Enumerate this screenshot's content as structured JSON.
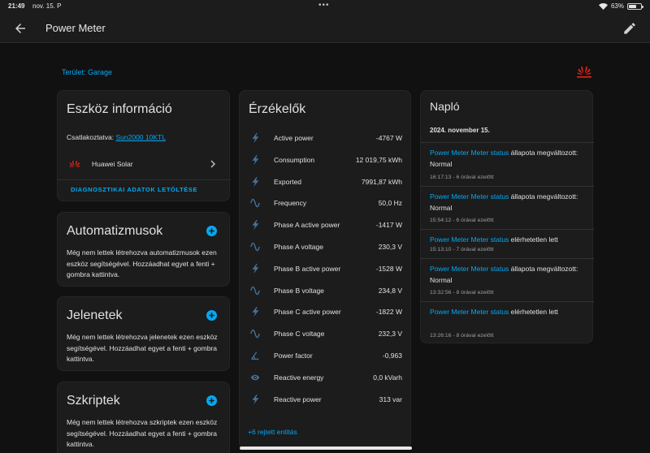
{
  "status_bar": {
    "time": "21:49",
    "date": "nov. 15. P",
    "battery": "63%",
    "battery_level": 0.63
  },
  "app_bar": {
    "title": "Power Meter",
    "back_icon": "arrow-left-icon",
    "edit_icon": "pencil-icon"
  },
  "area": "Terület: Garage",
  "device_info": {
    "title": "Eszköz információ",
    "connected_prefix": "Csatlakoztatva: ",
    "connected_link": "Sun2000 10KTL",
    "manufacturer": "Huawei Solar",
    "diagnostics_button": "DIAGNOSZTIKAI ADATOK LETÖLTÉSE"
  },
  "automations": {
    "title": "Automatizmusok",
    "text": "Még nem lettek létrehozva automatizmusok ezen eszköz segítségével. Hozzáadhat egyet a fenti + gombra kattintva."
  },
  "scenes": {
    "title": "Jelenetek",
    "text": "Még nem lettek létrehozva jelenetek ezen eszköz segítségével. Hozzáadhat egyet a fenti + gombra kattintva."
  },
  "scripts": {
    "title": "Szkriptek",
    "text": "Még nem lettek létrehozva szkriptek ezen eszköz segítségével. Hozzáadhat egyet a fenti + gombra kattintva."
  },
  "sensors": {
    "title": "Érzékelők",
    "hidden_link": "+6 rejtett entitás",
    "items": [
      {
        "label": "Active power",
        "value": "-4767 W",
        "icon": "flash-icon"
      },
      {
        "label": "Consumption",
        "value": "12 019,75 kWh",
        "icon": "flash-icon"
      },
      {
        "label": "Exported",
        "value": "7991,87 kWh",
        "icon": "flash-icon"
      },
      {
        "label": "Frequency",
        "value": "50,0 Hz",
        "icon": "sine-wave-icon"
      },
      {
        "label": "Phase A active power",
        "value": "-1417 W",
        "icon": "flash-icon"
      },
      {
        "label": "Phase A voltage",
        "value": "230,3 V",
        "icon": "sine-wave-icon"
      },
      {
        "label": "Phase B active power",
        "value": "-1528 W",
        "icon": "flash-icon"
      },
      {
        "label": "Phase B voltage",
        "value": "234,8 V",
        "icon": "sine-wave-icon"
      },
      {
        "label": "Phase C active power",
        "value": "-1822 W",
        "icon": "flash-icon"
      },
      {
        "label": "Phase C voltage",
        "value": "232,3 V",
        "icon": "sine-wave-icon"
      },
      {
        "label": "Power factor",
        "value": "-0,963",
        "icon": "angle-acute-icon"
      },
      {
        "label": "Reactive energy",
        "value": "0,0 kVarh",
        "icon": "eye-icon"
      },
      {
        "label": "Reactive power",
        "value": "313 var",
        "icon": "flash-icon"
      }
    ]
  },
  "logbook": {
    "title": "Napló",
    "date": "2024. november 15.",
    "entries": [
      {
        "entity": "Power Meter Meter status",
        "action": " állapota megváltozott: Normal",
        "meta": "16:17:13 - 6 órával ezelőtt"
      },
      {
        "entity": "Power Meter Meter status",
        "action": " állapota megváltozott: Normal",
        "meta": "15:54:12 - 6 órával ezelőtt"
      },
      {
        "entity": "Power Meter Meter status",
        "action": " elérhetetlen lett",
        "meta": "15:13:10 - 7 órával ezelőtt"
      },
      {
        "entity": "Power Meter Meter status",
        "action": " állapota megváltozott: Normal",
        "meta": "13:32:56 - 8 órával ezelőtt"
      },
      {
        "entity": "Power Meter Meter status",
        "action": " elérhetetlen lett",
        "meta": "13:26:16 - 8 órával ezelőtt"
      }
    ]
  },
  "colors": {
    "accent": "#03a9f4",
    "background": "#111111",
    "card": "#1c1c1c",
    "icon": "#44739e",
    "huawei_red": "#e2231a"
  }
}
